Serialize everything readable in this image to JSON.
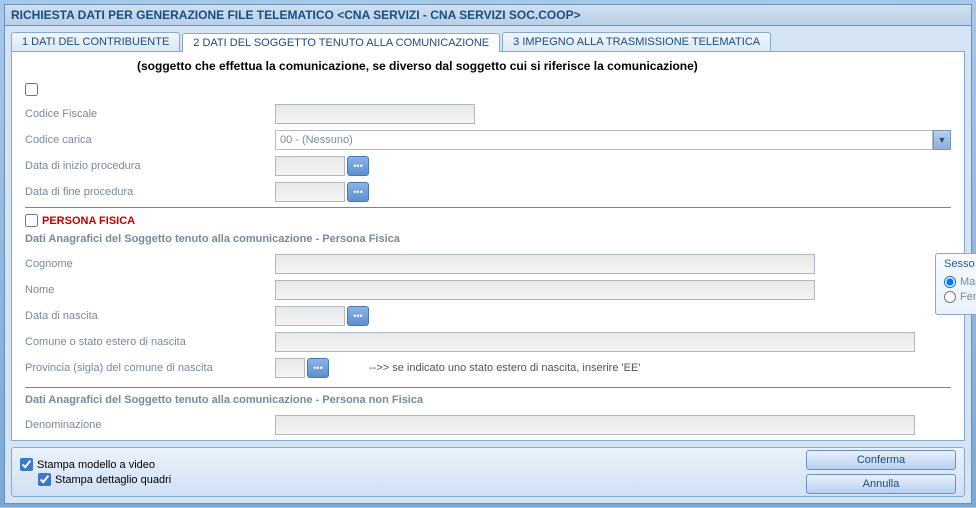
{
  "title": "RICHIESTA DATI PER GENERAZIONE FILE TELEMATICO <CNA SERVIZI - CNA SERVIZI SOC.COOP>",
  "tabs": [
    {
      "label": "1 DATI DEL CONTRIBUENTE"
    },
    {
      "label": "2 DATI DEL SOGGETTO TENUTO ALLA COMUNICAZIONE"
    },
    {
      "label": "3 IMPEGNO ALLA TRASMISSIONE TELEMATICA"
    }
  ],
  "subtitle": "(soggetto che effettua la comunicazione, se diverso dal soggetto cui si riferisce la comunicazione)",
  "fields": {
    "codice_fiscale_label": "Codice Fiscale",
    "codice_fiscale_value": "",
    "codice_carica_label": "Codice carica",
    "codice_carica_value": "00 - (Nessuno)",
    "data_inizio_label": "Data di inizio procedura",
    "data_inizio_value": "",
    "data_fine_label": "Data di fine procedura",
    "data_fine_value": ""
  },
  "persona_fisica": {
    "checkbox_label": "PERSONA FISICA",
    "section_title": "Dati Anagrafici del Soggetto tenuto alla comunicazione - Persona Fisica",
    "cognome_label": "Cognome",
    "cognome_value": "",
    "nome_label": "Nome",
    "nome_value": "",
    "data_nascita_label": "Data di nascita",
    "data_nascita_value": "",
    "comune_label": "Comune o stato estero di nascita",
    "comune_value": "",
    "provincia_label": "Provincia (sigla) del comune di nascita",
    "provincia_value": "",
    "provincia_hint": "-->> se indicato uno stato estero di nascita, inserire 'EE'",
    "sesso_title": "Sesso",
    "sesso_maschio": "Maschio",
    "sesso_femmina": "Femmina"
  },
  "persona_non_fisica": {
    "section_title": "Dati Anagrafici del Soggetto tenuto alla comunicazione - Persona non Fisica",
    "denominazione_label": "Denominazione",
    "denominazione_value": ""
  },
  "bottom": {
    "stampa_modello": "Stampa modello a video",
    "stampa_dettaglio": "Stampa dettaglio quadri",
    "conferma": "Conferma",
    "annulla": "Annulla"
  }
}
